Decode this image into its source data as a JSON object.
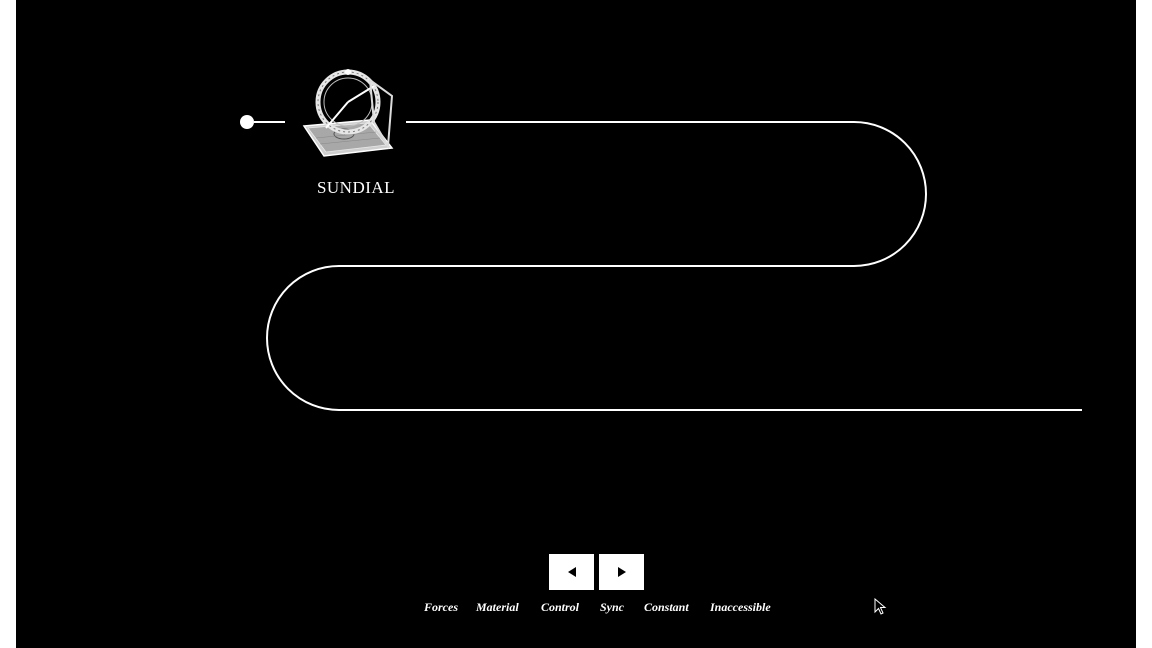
{
  "timeline": {
    "current_item": {
      "label": "SUNDIAL",
      "icon": "sundial-icon"
    }
  },
  "navigation": {
    "prev_icon": "triangle-left-icon",
    "next_icon": "triangle-right-icon"
  },
  "chapters": [
    {
      "label": "Forces"
    },
    {
      "label": "Material"
    },
    {
      "label": "Control"
    },
    {
      "label": "Sync"
    },
    {
      "label": "Constant"
    },
    {
      "label": "Inaccessible"
    }
  ],
  "colors": {
    "background": "#000000",
    "foreground": "#ffffff",
    "frame": "#ffffff"
  }
}
